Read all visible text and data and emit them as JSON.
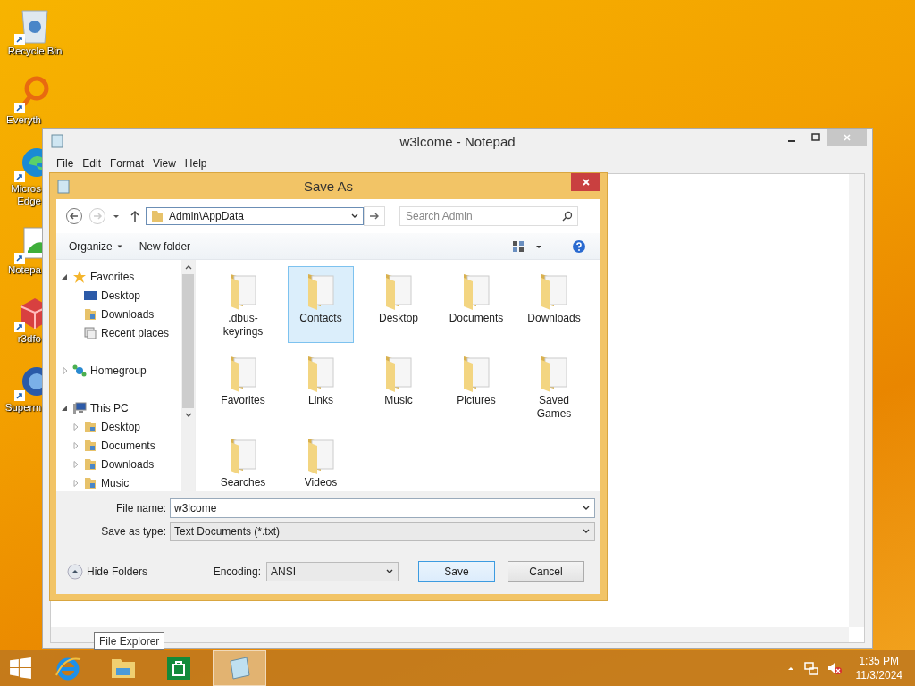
{
  "desktop_icons": [
    {
      "label": "Recycle Bin",
      "kind": "bin"
    },
    {
      "label": "Everyth",
      "kind": "search"
    },
    {
      "label": "Micros Edge",
      "kind": "edge"
    },
    {
      "label": "Notepa",
      "kind": "notepad"
    },
    {
      "label": "r3dfo",
      "kind": "cube"
    },
    {
      "label": "Superm",
      "kind": "globe"
    }
  ],
  "notepad": {
    "title": "w3lcome - Notepad",
    "menu": [
      "File",
      "Edit",
      "Format",
      "View",
      "Help"
    ]
  },
  "dialog": {
    "title": "Save As",
    "address": "Admin\\AppData",
    "search_placeholder": "Search Admin",
    "organize": "Organize",
    "new_folder": "New folder",
    "tree": [
      {
        "label": "Favorites",
        "kind": "star",
        "expanded": true,
        "children": [
          {
            "label": "Desktop",
            "kind": "monitor"
          },
          {
            "label": "Downloads",
            "kind": "folder"
          },
          {
            "label": "Recent places",
            "kind": "recent"
          }
        ]
      },
      {
        "label": "Homegroup",
        "kind": "network",
        "expanded": false
      },
      {
        "label": "This PC",
        "kind": "computer",
        "expanded": true,
        "children": [
          {
            "label": "Desktop",
            "kind": "folder",
            "expanded": false
          },
          {
            "label": "Documents",
            "kind": "folder",
            "expanded": false
          },
          {
            "label": "Downloads",
            "kind": "folder",
            "expanded": false
          },
          {
            "label": "Music",
            "kind": "folder",
            "expanded": false
          }
        ]
      }
    ],
    "items": [
      {
        "label": ".dbus-keyrings",
        "selected": false
      },
      {
        "label": "Contacts",
        "selected": true
      },
      {
        "label": "Desktop",
        "selected": false
      },
      {
        "label": "Documents",
        "selected": false
      },
      {
        "label": "Downloads",
        "selected": false
      },
      {
        "label": "Favorites",
        "selected": false
      },
      {
        "label": "Links",
        "selected": false
      },
      {
        "label": "Music",
        "selected": false
      },
      {
        "label": "Pictures",
        "selected": false
      },
      {
        "label": "Saved Games",
        "selected": false
      },
      {
        "label": "Searches",
        "selected": false
      },
      {
        "label": "Videos",
        "selected": false
      }
    ],
    "file_name_label": "File name:",
    "file_name": "w3lcome",
    "type_label": "Save as type:",
    "type": "Text Documents (*.txt)",
    "hide_folders": "Hide Folders",
    "encoding_label": "Encoding:",
    "encoding": "ANSI",
    "save": "Save",
    "cancel": "Cancel"
  },
  "tooltip": "File Explorer",
  "clock": {
    "time": "1:35 PM",
    "date": "11/3/2024"
  }
}
